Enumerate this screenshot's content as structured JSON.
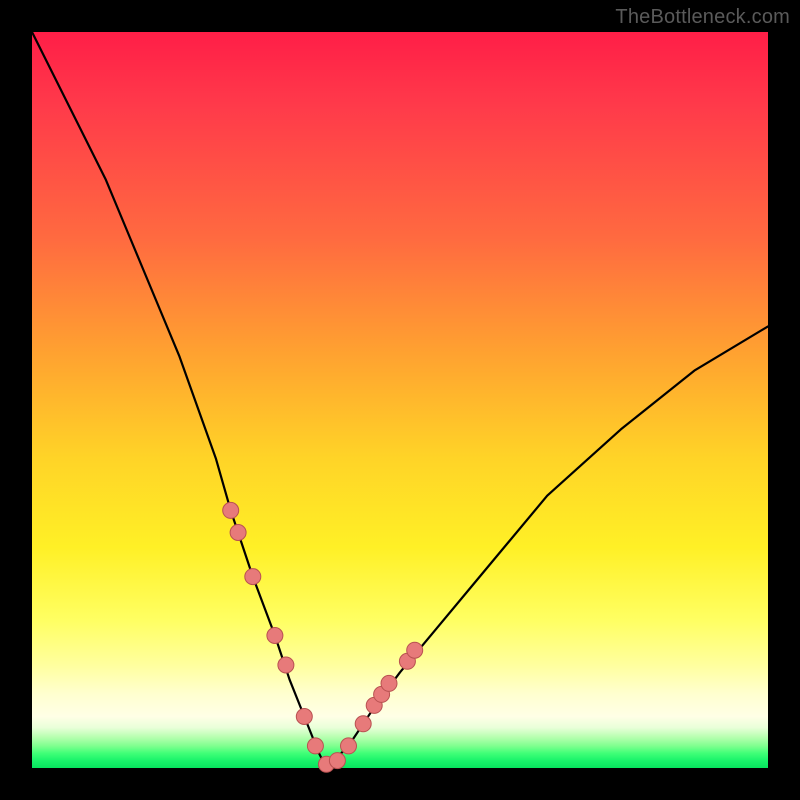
{
  "watermark": "TheBottleneck.com",
  "colors": {
    "curve_stroke": "#000000",
    "marker_fill": "#e77a7a",
    "marker_stroke": "#b95151",
    "frame": "#000000"
  },
  "chart_data": {
    "type": "line",
    "title": "",
    "xlabel": "",
    "ylabel": "",
    "xlim": [
      0,
      100
    ],
    "ylim": [
      0,
      100
    ],
    "grid": false,
    "legend": false,
    "note": "V-shaped bottleneck curve; y roughly proportional to |x - 40|, steeper on the left branch; minimum (y≈0) near x≈40; right branch rises to ~60 at x=100. Axis values are estimated from visual proportions since no tick labels are shown.",
    "series": [
      {
        "name": "bottleneck-curve",
        "x": [
          0,
          5,
          10,
          15,
          20,
          25,
          27,
          30,
          33,
          35,
          37,
          39,
          40,
          41,
          43,
          45,
          47,
          50,
          55,
          60,
          70,
          80,
          90,
          100
        ],
        "y": [
          100,
          90,
          80,
          68,
          56,
          42,
          35,
          26,
          18,
          12,
          7,
          2,
          0,
          1,
          3,
          6,
          9,
          13,
          19,
          25,
          37,
          46,
          54,
          60
        ]
      }
    ],
    "markers": {
      "name": "highlight-points",
      "x": [
        27.0,
        28.0,
        30.0,
        33.0,
        34.5,
        37.0,
        38.5,
        40.0,
        41.5,
        43.0,
        45.0,
        46.5,
        47.5,
        48.5,
        51.0,
        52.0
      ],
      "y": [
        35.0,
        32.0,
        26.0,
        18.0,
        14.0,
        7.0,
        3.0,
        0.5,
        1.0,
        3.0,
        6.0,
        8.5,
        10.0,
        11.5,
        14.5,
        16.0
      ]
    }
  }
}
